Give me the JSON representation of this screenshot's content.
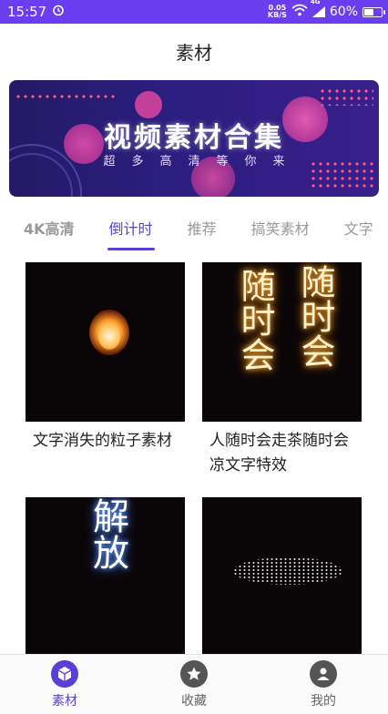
{
  "status_bar": {
    "time": "15:57",
    "net_speed_value": "0.05",
    "net_speed_unit": "KB/S",
    "network": "4G",
    "battery": "60%",
    "battery_level": 0.6
  },
  "header": {
    "title": "素材"
  },
  "banner": {
    "title": "视频素材合集",
    "subtitle": "超多高清等你来"
  },
  "tabs": [
    {
      "label": "4K高清"
    },
    {
      "label": "倒计时"
    },
    {
      "label": "推荐"
    },
    {
      "label": "搞笑素材"
    },
    {
      "label": "文字"
    }
  ],
  "active_tab": "倒计时",
  "cards": [
    {
      "title": "文字消失的粒子素材"
    },
    {
      "title": "人随时会走茶随时会凉文字特效",
      "glow_chars": "随时会"
    },
    {
      "title": "",
      "glow_chars": "解放"
    },
    {
      "title": ""
    }
  ],
  "bottom_nav": [
    {
      "label": "素材",
      "icon": "cube-icon"
    },
    {
      "label": "收藏",
      "icon": "star-icon"
    },
    {
      "label": "我的",
      "icon": "user-icon"
    }
  ],
  "colors": {
    "status_bar": "#6a3df0",
    "accent": "#5b3ed6",
    "banner_bg": "#2c1e80"
  }
}
